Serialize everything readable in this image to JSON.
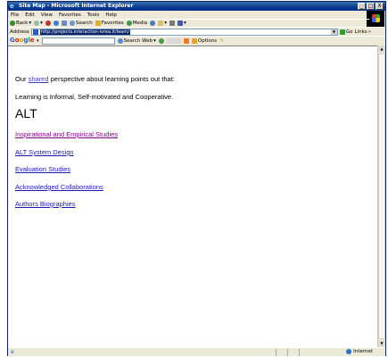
{
  "window": {
    "title": "Site Map - Microsoft Internet Explorer",
    "minimize": "_",
    "maximize": "□",
    "close": "X"
  },
  "menu": [
    "File",
    "Edit",
    "View",
    "Favorites",
    "Tools",
    "Help"
  ],
  "toolbar": {
    "back": "Back",
    "search": "Search",
    "favorites": "Favorites",
    "media": "Media"
  },
  "address": {
    "label": "Address",
    "url": "http://projects.interaction-ivrea.it/learn/",
    "go": "Go",
    "links": "Links"
  },
  "google": {
    "search_web": "Search Web",
    "options": "Options"
  },
  "content": {
    "intro_prefix": "Our ",
    "intro_link": "shared",
    "intro_suffix": " perspective about learning points out that:",
    "intro2": "Learning is Informal, Self-motivated and Cooperative.",
    "heading": "ALT",
    "links": [
      "Inspirational and Empirical Studies",
      "ALT System Design",
      "Evaluation Studies",
      "Acknowledged Collaborations",
      "Authors Biographies"
    ]
  },
  "status": {
    "zone": "Internet"
  },
  "colors": {
    "visited_link": "#800080",
    "link": "#1a1ab8"
  }
}
